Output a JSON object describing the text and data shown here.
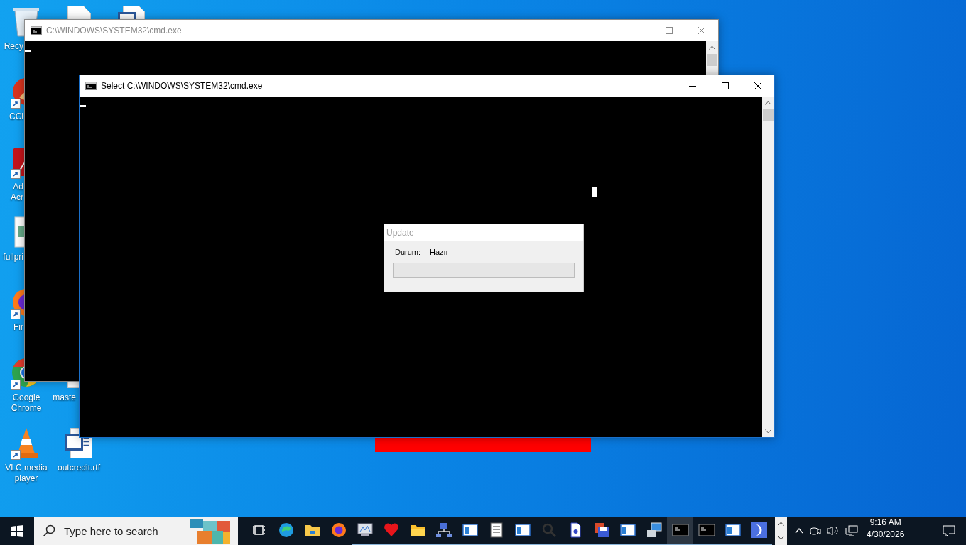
{
  "desktop": {
    "columns": [
      [
        {
          "kind": "icon",
          "label": "Recy",
          "cut": true,
          "shortcut": false
        },
        {
          "kind": "icon",
          "label": "CCl",
          "cut": true,
          "shortcut": true
        },
        {
          "kind": "icon",
          "label": "Ad Acr",
          "cut": true,
          "shortcut": true
        },
        {
          "kind": "icon",
          "label": "fullpri",
          "cut": true,
          "shortcut": false
        },
        {
          "kind": "icon",
          "label": "Fir",
          "cut": true,
          "shortcut": true
        },
        {
          "kind": "icon",
          "label": "Google Chrome",
          "cut": false,
          "shortcut": true
        },
        {
          "kind": "icon",
          "label": "VLC media player",
          "cut": false,
          "shortcut": true
        }
      ],
      [
        {
          "kind": "icon",
          "shortcut": false
        },
        {
          "kind": "empty"
        },
        {
          "kind": "empty"
        },
        {
          "kind": "empty"
        },
        {
          "kind": "empty"
        },
        {
          "kind": "icon",
          "label": "maste",
          "cut": true,
          "shortcut": false
        },
        {
          "kind": "icon",
          "label": "outcredit.rtf",
          "cut": false,
          "shortcut": false
        }
      ],
      [
        {
          "kind": "icon",
          "shortcut": false
        }
      ]
    ]
  },
  "windows": [
    {
      "title": "C:\\WINDOWS\\SYSTEM32\\cmd.exe",
      "active": false
    },
    {
      "title": "Select C:\\WINDOWS\\SYSTEM32\\cmd.exe",
      "active": true
    }
  ],
  "dialog": {
    "title": "Update",
    "status_label": "Durum:",
    "status_value": "Hazır",
    "progress": {
      "level": 0
    }
  },
  "taskbar": {
    "search": {
      "placeholder": "Type here to search"
    },
    "apps": [
      {
        "running": false,
        "active": false
      },
      {
        "running": false,
        "active": false
      },
      {
        "running": false,
        "active": false
      },
      {
        "running": false,
        "active": false
      },
      {
        "running": true,
        "active": false
      },
      {
        "running": true,
        "active": false
      },
      {
        "running": true,
        "active": false
      },
      {
        "running": true,
        "active": false
      },
      {
        "running": true,
        "active": false
      },
      {
        "running": true,
        "active": false
      },
      {
        "running": true,
        "active": false
      },
      {
        "running": true,
        "active": false
      },
      {
        "running": true,
        "active": false
      },
      {
        "running": true,
        "active": false
      },
      {
        "running": true,
        "active": false
      },
      {
        "running": true,
        "active": false
      },
      {
        "running": true,
        "active": true
      },
      {
        "running": true,
        "active": false
      },
      {
        "running": true,
        "active": false
      },
      {
        "running": true,
        "active": false
      }
    ],
    "clock": {
      "time": "9:16 AM",
      "date": "4/30/2026"
    }
  }
}
